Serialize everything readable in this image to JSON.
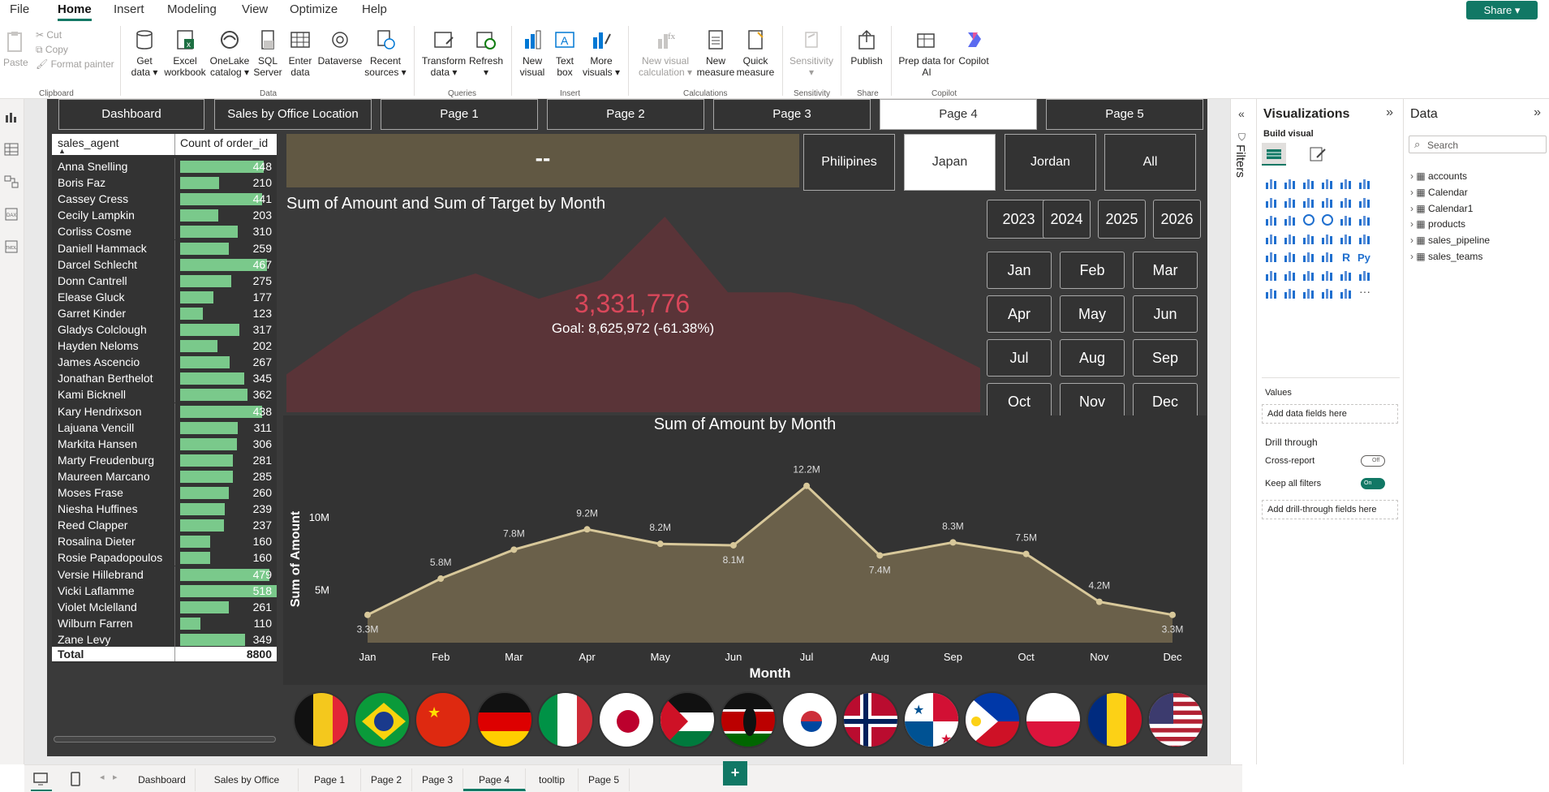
{
  "menu": {
    "items": [
      "File",
      "Home",
      "Insert",
      "Modeling",
      "View",
      "Optimize",
      "Help"
    ],
    "active": "Home",
    "share": "Share"
  },
  "ribbon": {
    "clipboard": {
      "paste": "Paste",
      "cut": "Cut",
      "copy": "Copy",
      "format_painter": "Format painter",
      "label": "Clipboard"
    },
    "data": {
      "get_data": "Get data",
      "excel": "Excel workbook",
      "onelake": "OneLake catalog",
      "sql": "SQL Server",
      "enter": "Enter data",
      "dataverse": "Dataverse",
      "recent": "Recent sources",
      "label": "Data"
    },
    "queries": {
      "transform": "Transform data",
      "refresh": "Refresh",
      "label": "Queries"
    },
    "insert": {
      "new_visual": "New visual",
      "text_box": "Text box",
      "more_visuals": "More visuals",
      "label": "Insert"
    },
    "calculations": {
      "new_visual_calc": "New visual calculation",
      "new_measure": "New measure",
      "quick_measure": "Quick measure",
      "label": "Calculations"
    },
    "sensitivity": {
      "sensitivity": "Sensitivity",
      "label": "Sensitivity"
    },
    "share": {
      "publish": "Publish",
      "label": "Share"
    },
    "copilot": {
      "prep": "Prep data for AI",
      "copilot": "Copilot",
      "label": "Copilot"
    }
  },
  "report_nav": [
    "Dashboard",
    "Sales by Office Location",
    "Page 1",
    "Page 2",
    "Page 3",
    "Page 4",
    "Page 5"
  ],
  "report_nav_selected": "Page 4",
  "table": {
    "col1": "sales_agent",
    "col2": "Count of order_id",
    "rows": [
      {
        "name": "Anna Snelling",
        "value": 448
      },
      {
        "name": "Boris Faz",
        "value": 210
      },
      {
        "name": "Cassey Cress",
        "value": 441
      },
      {
        "name": "Cecily Lampkin",
        "value": 203
      },
      {
        "name": "Corliss Cosme",
        "value": 310
      },
      {
        "name": "Daniell Hammack",
        "value": 259
      },
      {
        "name": "Darcel Schlecht",
        "value": 467
      },
      {
        "name": "Donn Cantrell",
        "value": 275
      },
      {
        "name": "Elease Gluck",
        "value": 177
      },
      {
        "name": "Garret Kinder",
        "value": 123
      },
      {
        "name": "Gladys Colclough",
        "value": 317
      },
      {
        "name": "Hayden Neloms",
        "value": 202
      },
      {
        "name": "James Ascencio",
        "value": 267
      },
      {
        "name": "Jonathan Berthelot",
        "value": 345
      },
      {
        "name": "Kami Bicknell",
        "value": 362
      },
      {
        "name": "Kary Hendrixson",
        "value": 438
      },
      {
        "name": "Lajuana Vencill",
        "value": 311
      },
      {
        "name": "Markita Hansen",
        "value": 306
      },
      {
        "name": "Marty Freudenburg",
        "value": 281
      },
      {
        "name": "Maureen Marcano",
        "value": 285
      },
      {
        "name": "Moses Frase",
        "value": 260
      },
      {
        "name": "Niesha Huffines",
        "value": 239
      },
      {
        "name": "Reed Clapper",
        "value": 237
      },
      {
        "name": "Rosalina Dieter",
        "value": 160
      },
      {
        "name": "Rosie Papadopoulos",
        "value": 160
      },
      {
        "name": "Versie Hillebrand",
        "value": 479
      },
      {
        "name": "Vicki Laflamme",
        "value": 518
      },
      {
        "name": "Violet Mclelland",
        "value": 261
      },
      {
        "name": "Wilburn Farren",
        "value": 110
      },
      {
        "name": "Zane Levy",
        "value": 349
      }
    ],
    "total_label": "Total",
    "total_value": "8800"
  },
  "kpi_card": "--",
  "country_buttons": [
    "Philipines",
    "Japan",
    "Jordan",
    "All"
  ],
  "country_selected": "Japan",
  "years": [
    "2023",
    "2024",
    "2025",
    "2026"
  ],
  "months": [
    "Jan",
    "Feb",
    "Mar",
    "Apr",
    "May",
    "Jun",
    "Jul",
    "Aug",
    "Sep",
    "Oct",
    "Nov",
    "Dec"
  ],
  "gauge": {
    "title": "Sum of Amount and Sum of Target by Month",
    "value": "3,331,776",
    "goal": "Goal: 8,625,972 (-61.38%)"
  },
  "chart_data": {
    "type": "area",
    "title": "Sum of Amount by Month",
    "xlabel": "Month",
    "ylabel": "Sum of Amount",
    "categories": [
      "Jan",
      "Feb",
      "Mar",
      "Apr",
      "May",
      "Jun",
      "Jul",
      "Aug",
      "Sep",
      "Oct",
      "Nov",
      "Dec"
    ],
    "values": [
      3.3,
      5.8,
      7.8,
      9.2,
      8.2,
      8.1,
      12.2,
      7.4,
      8.3,
      7.5,
      4.2,
      3.3
    ],
    "labels": [
      "3.3M",
      "5.8M",
      "7.8M",
      "9.2M",
      "8.2M",
      "8.1M",
      "12.2M",
      "7.4M",
      "8.3M",
      "7.5M",
      "4.2M",
      "3.3M"
    ],
    "yticks": [
      "5M",
      "10M"
    ],
    "ylim": [
      2.5,
      12.8
    ],
    "color": "#d8c89a"
  },
  "background_chart": {
    "values": [
      3.0,
      6.5,
      9.5,
      11.0,
      9.0,
      10.5,
      15.5,
      9.5,
      9.5,
      8.5,
      6.0,
      3.5
    ]
  },
  "flags": [
    "belgium",
    "brazil",
    "china",
    "germany",
    "italy",
    "japan",
    "jordan",
    "kenya",
    "south-korea",
    "norway",
    "panama",
    "philippines",
    "poland",
    "romania",
    "usa"
  ],
  "filters_label": "Filters",
  "viz_pane": {
    "title": "Visualizations",
    "build": "Build visual",
    "values": "Values",
    "add_fields": "Add data fields here",
    "drill": "Drill through",
    "cross_report": "Cross-report",
    "cross_state": "Off",
    "keep_filters": "Keep all filters",
    "keep_state": "On",
    "add_drill": "Add drill-through fields here"
  },
  "data_pane": {
    "title": "Data",
    "search": "Search",
    "tables": [
      "accounts",
      "Calendar",
      "Calendar1",
      "products",
      "sales_pipeline",
      "sales_teams"
    ]
  },
  "tabs": [
    "Dashboard",
    "Sales by Office Location",
    "Page 1",
    "Page 2",
    "Page 3",
    "Page 4",
    "tooltip",
    "Page 5"
  ],
  "tab_selected": "Page 4",
  "colors": {
    "accent": "#117865",
    "bar": "#7ac98b",
    "card": "#615843",
    "gauge": "#d9475a"
  }
}
